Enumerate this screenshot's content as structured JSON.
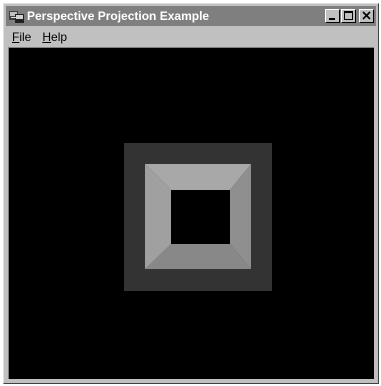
{
  "window": {
    "title": "Perspective Projection Example",
    "app_icon": "app-icon",
    "caption_buttons": [
      "minimize-icon",
      "maximize-icon",
      "close-icon"
    ]
  },
  "menu": {
    "items": [
      {
        "label_first": "F",
        "label_rest": "ile"
      },
      {
        "label_first": "H",
        "label_rest": "elp"
      }
    ]
  },
  "colors": {
    "titlebar": "#7f7f7f",
    "client_background": "#000000",
    "outer_square": "#333333",
    "inner_frame": "#9a9a9a",
    "hole": "#000000"
  }
}
